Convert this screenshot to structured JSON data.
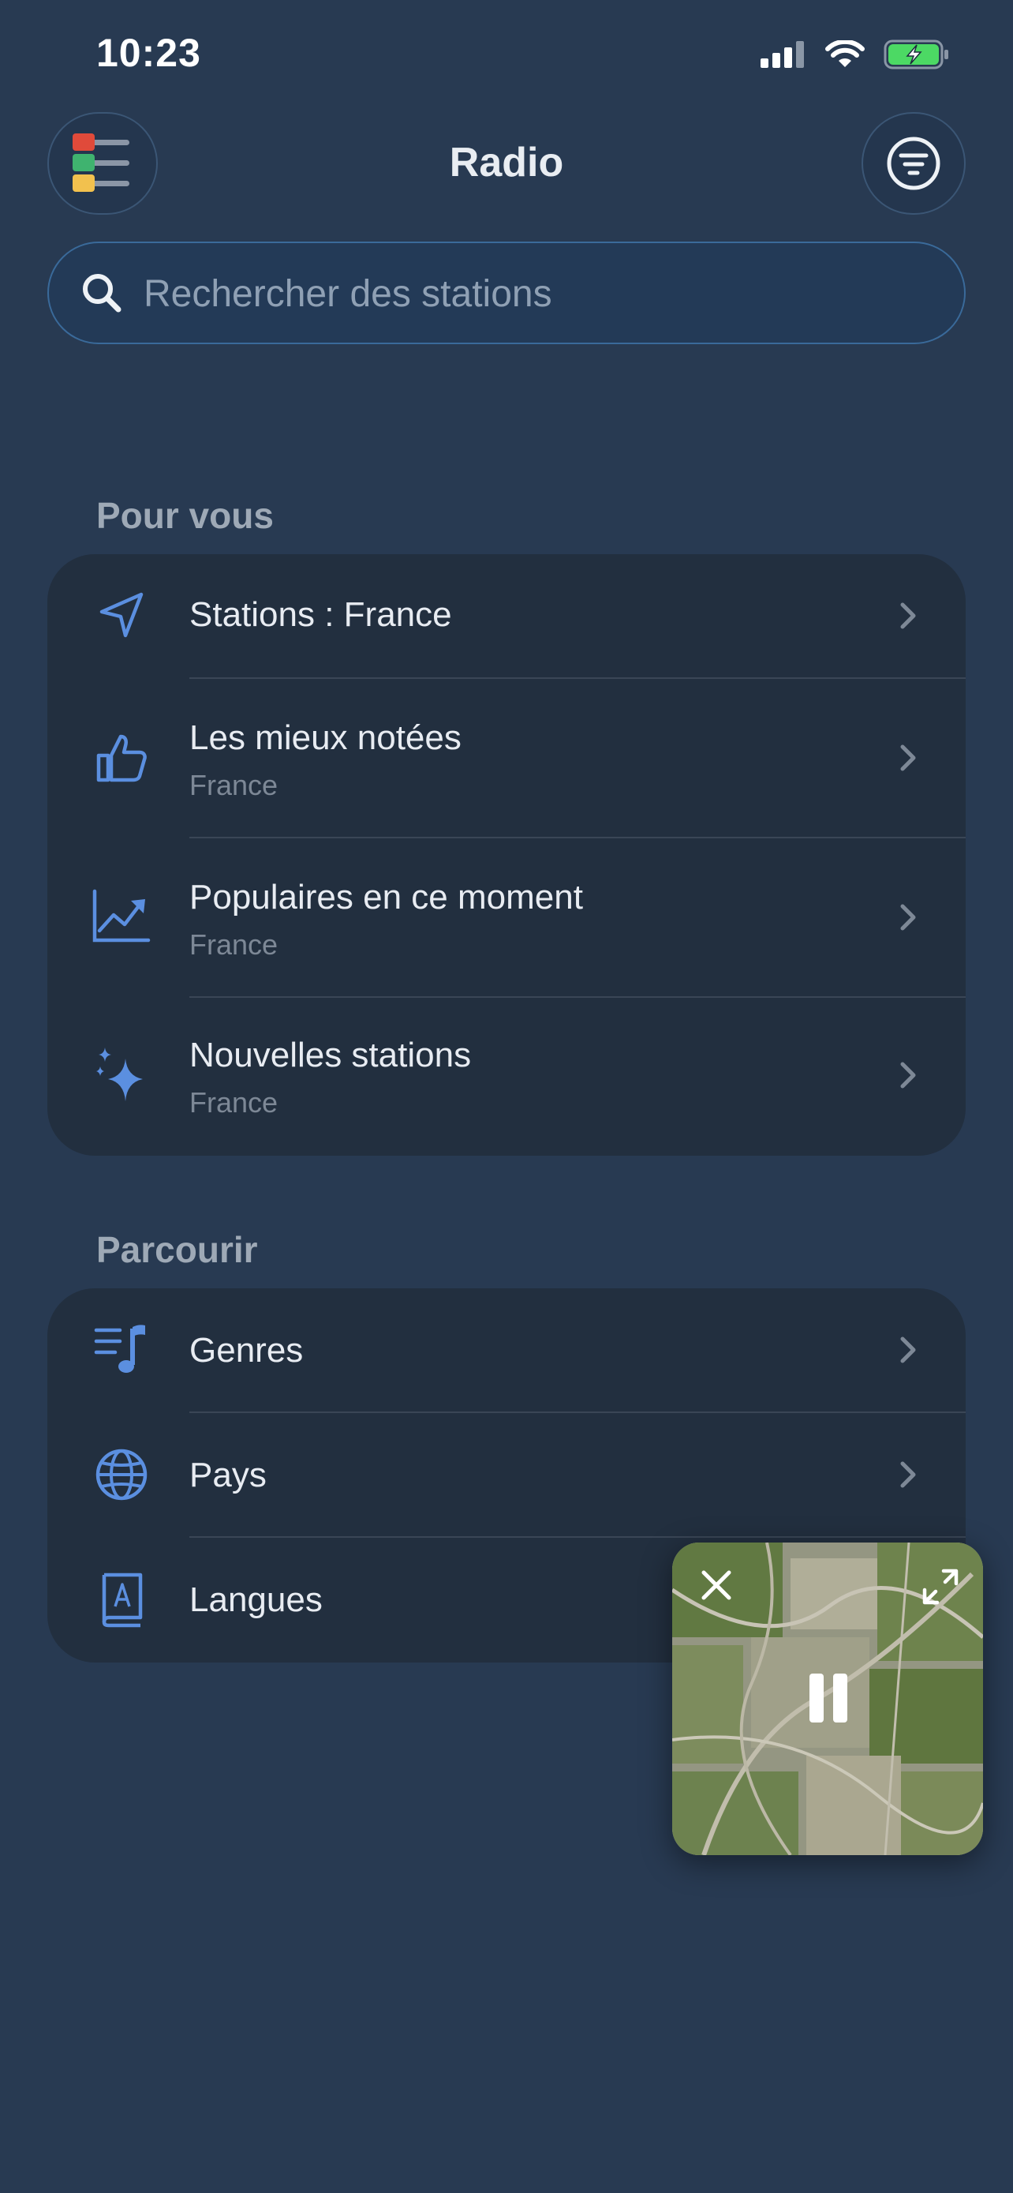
{
  "status": {
    "time": "10:23"
  },
  "header": {
    "title": "Radio"
  },
  "search": {
    "placeholder": "Rechercher des stations"
  },
  "for_you": {
    "title": "Pour vous",
    "items": [
      {
        "label": "Stations : France",
        "icon": "location-arrow-icon"
      },
      {
        "label": "Les mieux notées",
        "sub": "France",
        "icon": "thumbs-up-icon"
      },
      {
        "label": "Populaires en ce moment",
        "sub": "France",
        "icon": "trending-chart-icon"
      },
      {
        "label": "Nouvelles stations",
        "sub": "France",
        "icon": "sparkles-icon"
      }
    ]
  },
  "browse": {
    "title": "Parcourir",
    "items": [
      {
        "label": "Genres",
        "icon": "music-list-icon"
      },
      {
        "label": "Pays",
        "icon": "globe-icon"
      },
      {
        "label": "Langues",
        "icon": "dictionary-icon"
      }
    ]
  },
  "colors": {
    "accent": "#5b8fe0",
    "background": "#283a52",
    "card": "#222f3f"
  }
}
